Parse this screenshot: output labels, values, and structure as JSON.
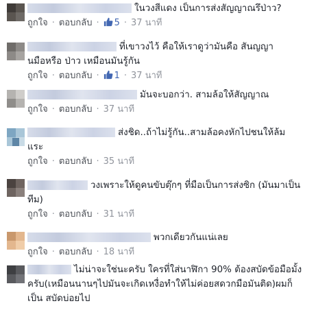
{
  "labels": {
    "like": "ถูกใจ",
    "reply": "ตอบกลับ",
    "separator": "·"
  },
  "comments": [
    {
      "text": "ในวงสีแดง เป็นการส่งสัญญาณรึป่าว?",
      "likes": "5",
      "time": "37 นาที"
    },
    {
      "text": "ที่เขาวงไว้ คือให้เราดูว่ามันคือ สันญญานมือหรือ ป่าว เหมือนมันรู้กัน",
      "likes": "1",
      "time": "37 นาที"
    },
    {
      "text": "มันจะบอกว่า. สามล้อให้สัญญาณ",
      "likes": null,
      "time": "37 นาที"
    },
    {
      "text": "ส่งชิด..ถ้าไม่รู้กัน..สามล้อคงหักไปชนให้ล้ม แระ",
      "likes": null,
      "time": "35 นาที"
    },
    {
      "text": "วงเพราะให้ดูคนขับตุ๊กๆ ที่มือเป็นการส่งซิก (มันมาเป็น ทีม)",
      "likes": null,
      "time": "31 นาที"
    },
    {
      "text": "พวกเดียวกันแน่เลย",
      "likes": null,
      "time": "18 นาที"
    },
    {
      "text": "ไม่น่าจะใช่นะครับ ใครที่ใส่นาฬิกา 90% ต้องสบัดข้อมือมั้ง ครับ(เหมือนนานๆไปมันจะเกิดเหงื่อทำให้ไม่ค่อยสดวกมือมันติด)ผมก็ เป็น สบัดบ่อยไป",
      "likes": null,
      "time": null
    }
  ],
  "colors": {
    "link": "#4b4f56",
    "meta": "#90949c",
    "like_count": "#4267b2",
    "text": "#1d2129"
  },
  "icons": {
    "like_count": "thumb-up-icon"
  }
}
